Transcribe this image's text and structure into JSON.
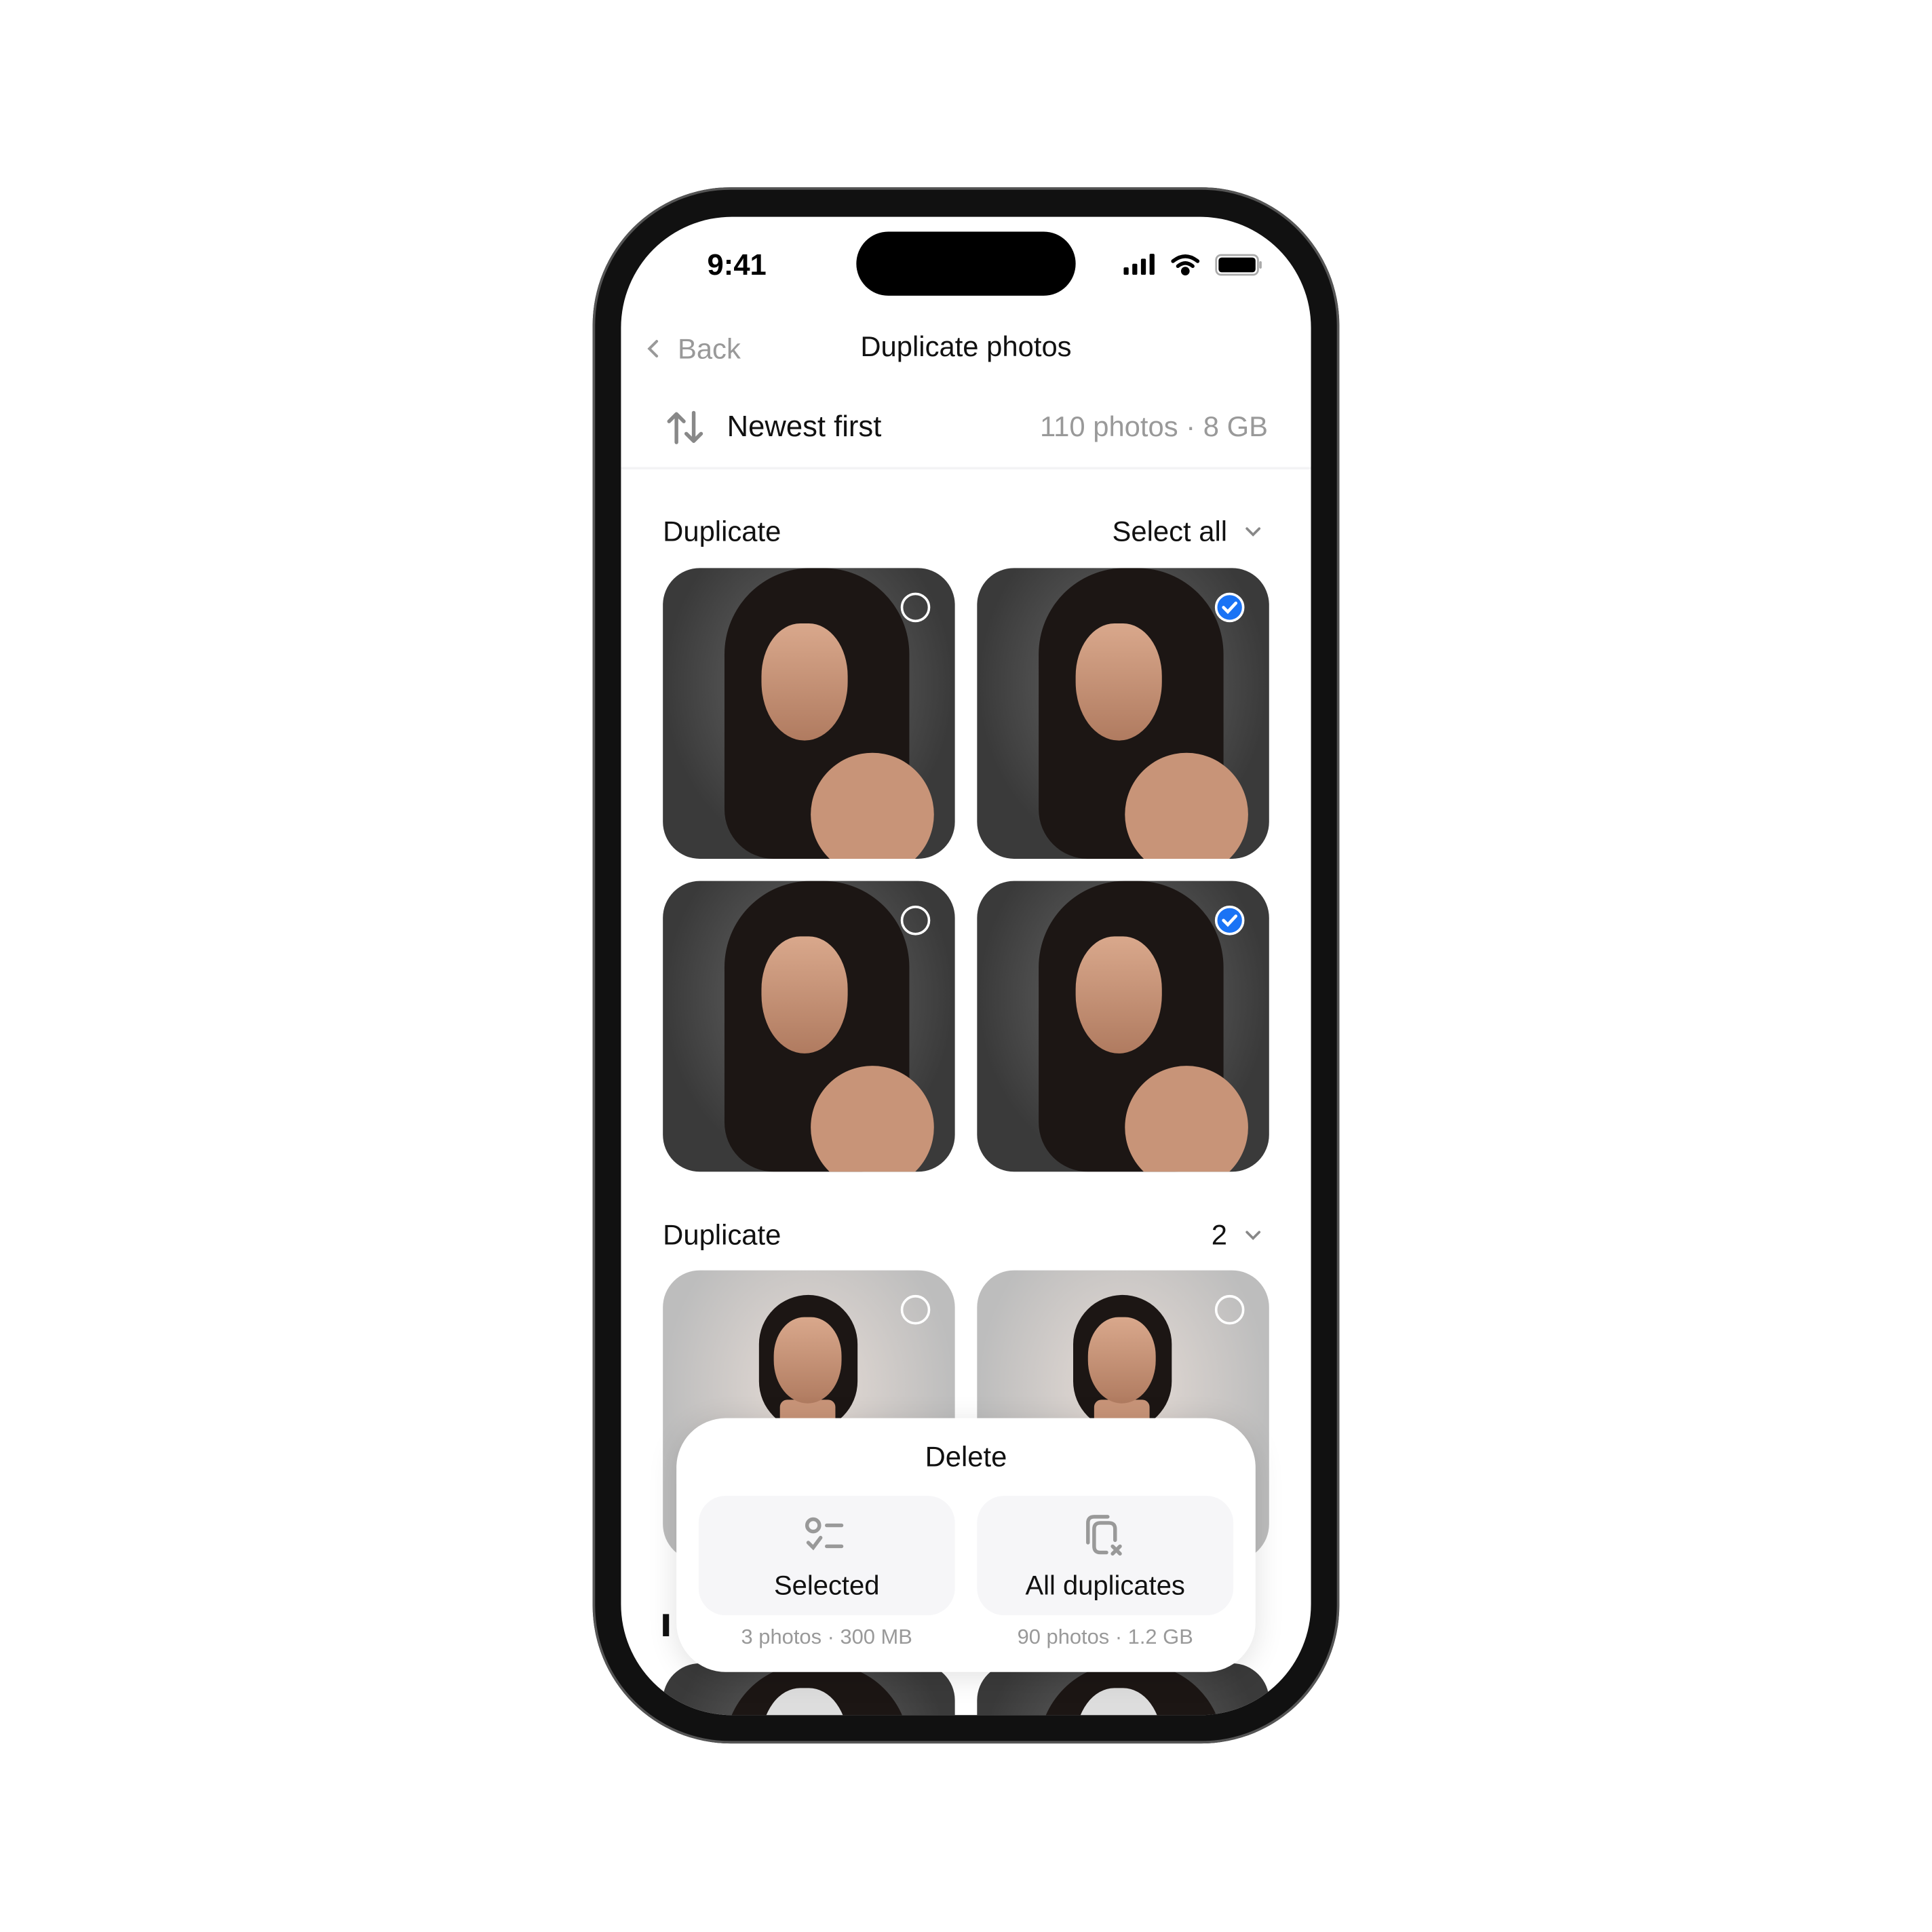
{
  "status_bar": {
    "time": "9:41",
    "icons": [
      "signal-icon",
      "wifi-icon",
      "battery-icon"
    ]
  },
  "nav": {
    "back_label": "Back",
    "title": "Duplicate photos"
  },
  "sort": {
    "label": "Newest first",
    "summary": "110 photos · 8 GB"
  },
  "groups": [
    {
      "title": "Duplicate",
      "action": "Select all",
      "photos": [
        {
          "selected": false
        },
        {
          "selected": true
        },
        {
          "selected": false
        },
        {
          "selected": true
        }
      ]
    },
    {
      "title": "Duplicate",
      "action": "2",
      "photos": [
        {
          "selected": false
        },
        {
          "selected": false
        }
      ]
    }
  ],
  "sheet": {
    "title": "Delete",
    "options": [
      {
        "label": "Selected",
        "detail": "3 photos · 300 MB",
        "icon": "checklist-icon"
      },
      {
        "label": "All duplicates",
        "detail": "90 photos · 1.2 GB",
        "icon": "copy-remove-icon"
      }
    ]
  },
  "colors": {
    "accent": "#1a73f5",
    "secondary_text": "#999999"
  }
}
